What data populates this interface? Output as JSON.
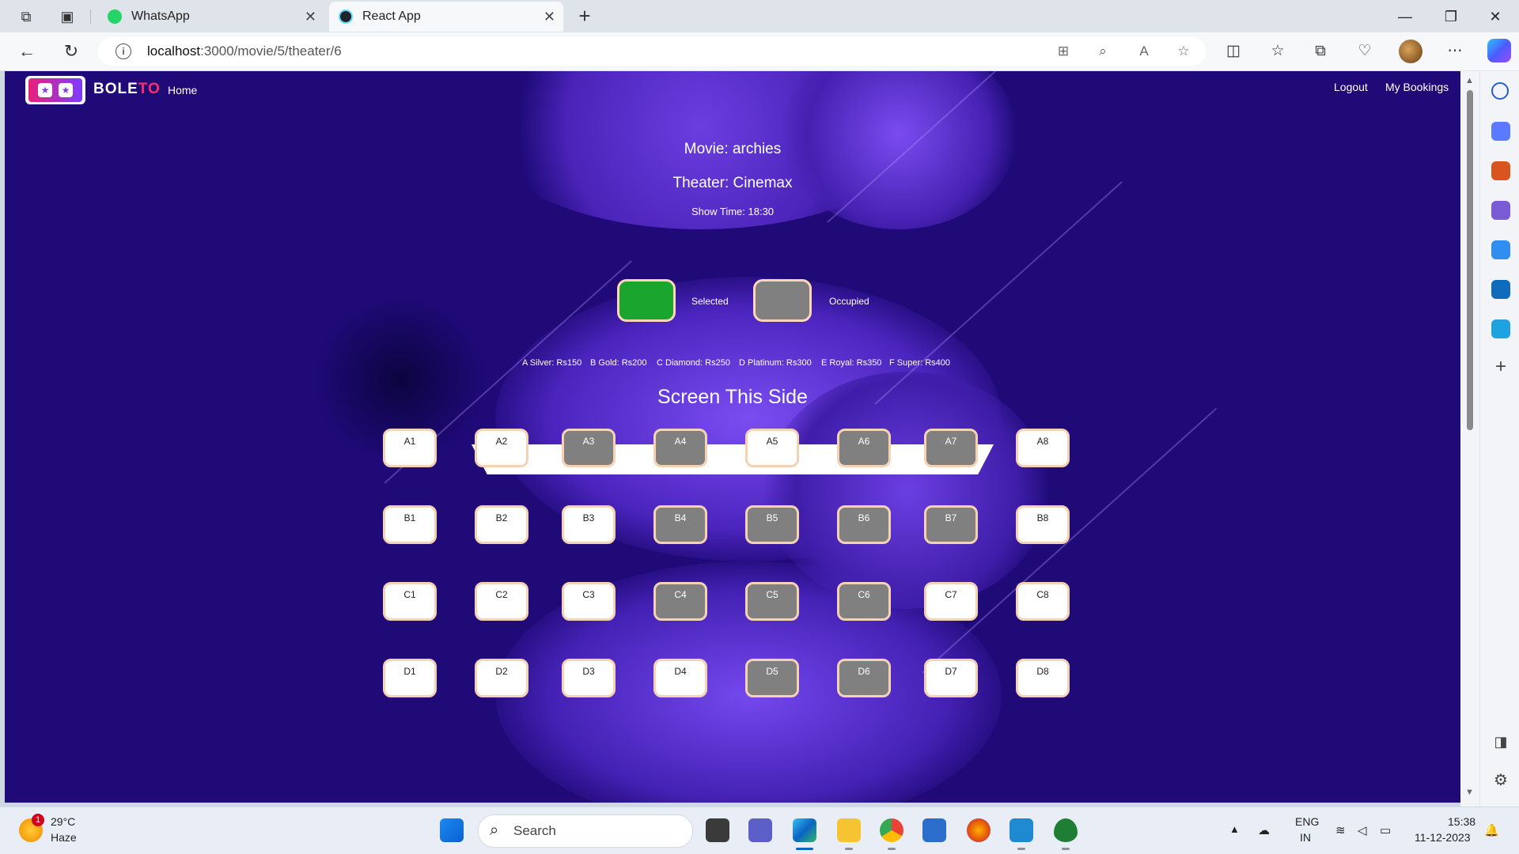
{
  "browser": {
    "tabs": [
      {
        "title": "WhatsApp",
        "active": false
      },
      {
        "title": "React App",
        "active": true
      }
    ],
    "url_host": "localhost",
    "url_path": ":3000/movie/5/theater/6"
  },
  "navbar": {
    "brand_a": "BOLE",
    "brand_b": "TO",
    "home": "Home",
    "logout": "Logout",
    "bookings": "My Bookings"
  },
  "show": {
    "movie": "Movie: archies",
    "theater": "Theater: Cinemax",
    "time": "Show Time: 18:30"
  },
  "legend": {
    "selected": "Selected",
    "occupied": "Occupied",
    "selected_color": "#1aa52f",
    "occupied_color": "#808080"
  },
  "prices": [
    "A Silver: Rs150",
    "B Gold: Rs200",
    "C Diamond: Rs250",
    "D Platinum: Rs300",
    "E Royal: Rs350",
    "F Super: Rs400"
  ],
  "screen_label": "Screen This Side",
  "seats": {
    "A": [
      {
        "id": "A1",
        "occupied": false
      },
      {
        "id": "A2",
        "occupied": false
      },
      {
        "id": "A3",
        "occupied": true
      },
      {
        "id": "A4",
        "occupied": true
      },
      {
        "id": "A5",
        "occupied": false
      },
      {
        "id": "A6",
        "occupied": true
      },
      {
        "id": "A7",
        "occupied": true
      },
      {
        "id": "A8",
        "occupied": false
      }
    ],
    "B": [
      {
        "id": "B1",
        "occupied": false
      },
      {
        "id": "B2",
        "occupied": false
      },
      {
        "id": "B3",
        "occupied": false
      },
      {
        "id": "B4",
        "occupied": true
      },
      {
        "id": "B5",
        "occupied": true
      },
      {
        "id": "B6",
        "occupied": true
      },
      {
        "id": "B7",
        "occupied": true
      },
      {
        "id": "B8",
        "occupied": false
      }
    ],
    "C": [
      {
        "id": "C1",
        "occupied": false
      },
      {
        "id": "C2",
        "occupied": false
      },
      {
        "id": "C3",
        "occupied": false
      },
      {
        "id": "C4",
        "occupied": true
      },
      {
        "id": "C5",
        "occupied": true
      },
      {
        "id": "C6",
        "occupied": true
      },
      {
        "id": "C7",
        "occupied": false
      },
      {
        "id": "C8",
        "occupied": false
      }
    ],
    "D": [
      {
        "id": "D1",
        "occupied": false
      },
      {
        "id": "D2",
        "occupied": false
      },
      {
        "id": "D3",
        "occupied": false
      },
      {
        "id": "D4",
        "occupied": false
      },
      {
        "id": "D5",
        "occupied": true
      },
      {
        "id": "D6",
        "occupied": true
      },
      {
        "id": "D7",
        "occupied": false
      },
      {
        "id": "D8",
        "occupied": false
      }
    ]
  },
  "taskbar": {
    "temp": "29°C",
    "weather": "Haze",
    "weather_badge": "1",
    "search": "Search",
    "lang1": "ENG",
    "lang2": "IN",
    "time": "15:38",
    "date": "11-12-2023"
  }
}
